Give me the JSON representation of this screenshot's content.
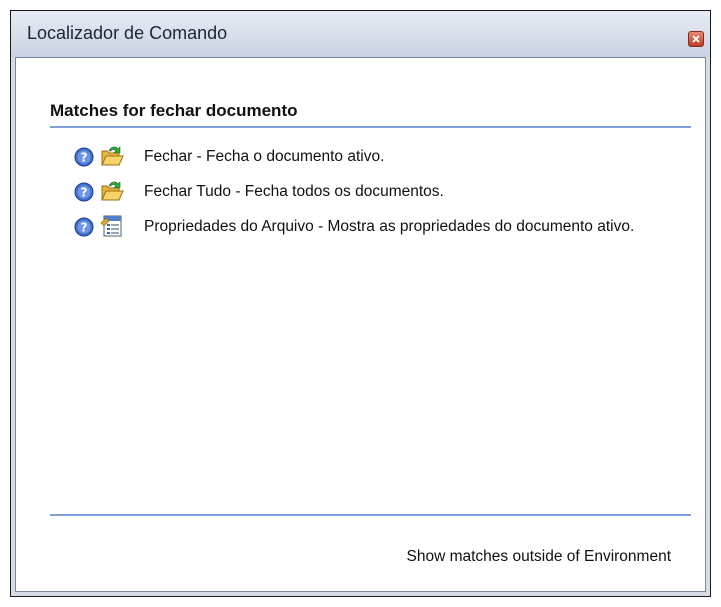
{
  "window": {
    "title": "Localizador de Comando"
  },
  "heading": "Matches for  fechar documento",
  "results": [
    {
      "text": "Fechar - Fecha o documento ativo.",
      "help_icon": "help-icon",
      "icon": "folder-open-icon"
    },
    {
      "text": "Fechar Tudo - Fecha todos os documentos.",
      "help_icon": "help-icon",
      "icon": "folder-open-icon"
    },
    {
      "text": "Propriedades do Arquivo - Mostra as propriedades do documento ativo.",
      "help_icon": "help-icon",
      "icon": "file-properties-icon"
    }
  ],
  "footer": {
    "link": "Show matches outside of Environment"
  },
  "colors": {
    "accent_rule": "#7fa0d6",
    "title_bar": "#c9d3e3",
    "close_button": "#bf3d24"
  }
}
